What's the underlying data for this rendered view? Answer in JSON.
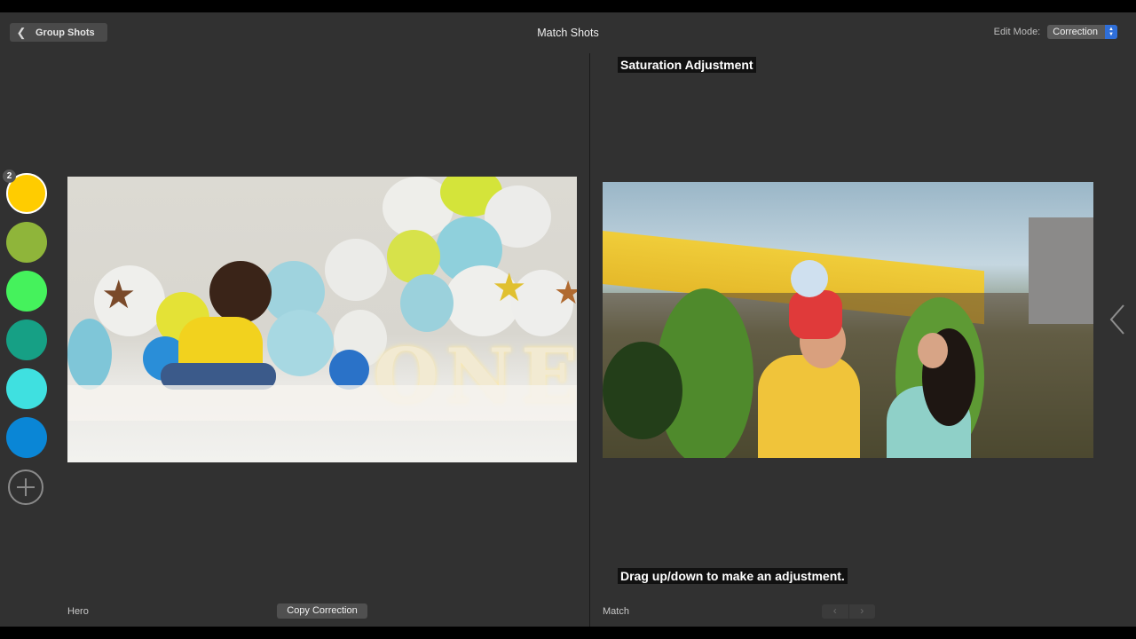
{
  "toolbar": {
    "back_label": "Group Shots",
    "title": "Match Shots",
    "edit_mode_label": "Edit Mode:",
    "edit_mode_value": "Correction"
  },
  "swatches": {
    "badge": "2",
    "colors": [
      "#ffcc00",
      "#8fb53a",
      "#45f25c",
      "#16a085",
      "#3fe0e0",
      "#0a86d6"
    ]
  },
  "overlays": {
    "top": "Saturation Adjustment",
    "bottom": "Drag up/down to make an adjustment."
  },
  "footer": {
    "hero_label": "Hero",
    "copy_button": "Copy Correction",
    "match_label": "Match"
  },
  "icons": {
    "back": "chevron-left-icon",
    "prev": "chevron-left-icon",
    "next": "chevron-right-icon",
    "side": "chevron-left-icon",
    "add": "plus-circle-icon"
  }
}
